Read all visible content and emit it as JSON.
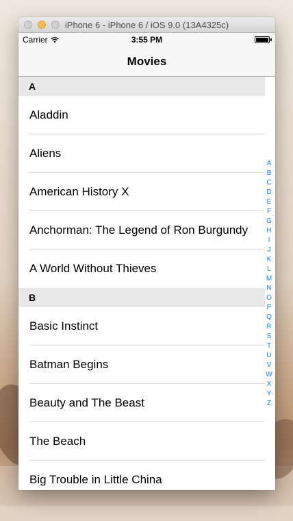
{
  "simulator": {
    "title": "iPhone 6 - iPhone 6 / iOS 9.0 (13A4325c)"
  },
  "status_bar": {
    "carrier": "Carrier",
    "time": "3:55 PM"
  },
  "nav": {
    "title": "Movies"
  },
  "sections": [
    {
      "header": "A",
      "rows": [
        "Aladdin",
        "Aliens",
        "American History X",
        "Anchorman: The Legend of Ron Burgundy",
        "A World Without Thieves"
      ]
    },
    {
      "header": "B",
      "rows": [
        "Basic Instinct",
        "Batman Begins",
        "Beauty and The Beast",
        "The Beach",
        "Big Trouble in Little China"
      ]
    }
  ],
  "index": [
    "A",
    "B",
    "C",
    "D",
    "E",
    "F",
    "G",
    "H",
    "I",
    "J",
    "K",
    "L",
    "M",
    "N",
    "O",
    "P",
    "Q",
    "R",
    "S",
    "T",
    "U",
    "V",
    "W",
    "X",
    "Y",
    "Z"
  ],
  "colors": {
    "index_tint": "#147efb",
    "section_bg": "#e8e8e8"
  }
}
